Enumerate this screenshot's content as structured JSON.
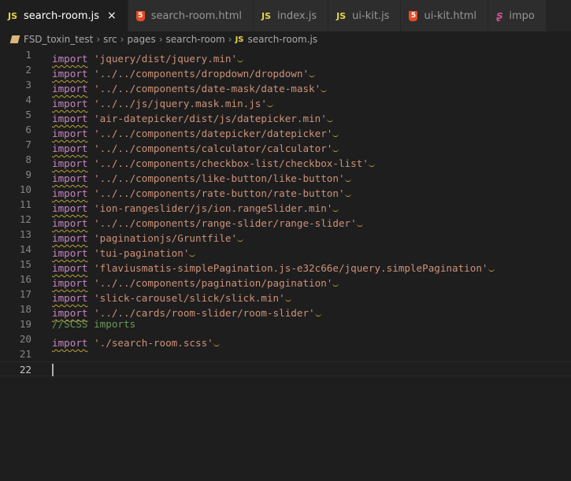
{
  "tabs": [
    {
      "icon": "js",
      "label": "search-room.js",
      "active": true
    },
    {
      "icon": "html",
      "label": "search-room.html",
      "active": false
    },
    {
      "icon": "js",
      "label": "index.js",
      "active": false
    },
    {
      "icon": "js",
      "label": "ui-kit.js",
      "active": false
    },
    {
      "icon": "html",
      "label": "ui-kit.html",
      "active": false
    },
    {
      "icon": "scss",
      "label": "impo",
      "active": false
    }
  ],
  "close_glyph": "×",
  "breadcrumb": {
    "segments": [
      "FSD_toxin_test",
      "src",
      "pages",
      "search-room"
    ],
    "file": "search-room.js"
  },
  "code": [
    {
      "n": "1",
      "kw": "import",
      "str": "'jquery/dist/jquery.min'"
    },
    {
      "n": "2",
      "kw": "import",
      "str": "'../../components/dropdown/dropdown'"
    },
    {
      "n": "3",
      "kw": "import",
      "str": "'../../components/date-mask/date-mask'"
    },
    {
      "n": "4",
      "kw": "import",
      "str": "'../../js/jquery.mask.min.js'"
    },
    {
      "n": "5",
      "kw": "import",
      "str": "'air-datepicker/dist/js/datepicker.min'"
    },
    {
      "n": "6",
      "kw": "import",
      "str": "'../../components/datepicker/datepicker'"
    },
    {
      "n": "7",
      "kw": "import",
      "str": "'../../components/calculator/calculator'"
    },
    {
      "n": "8",
      "kw": "import",
      "str": "'../../components/checkbox-list/checkbox-list'"
    },
    {
      "n": "9",
      "kw": "import",
      "str": "'../../components/like-button/like-button'"
    },
    {
      "n": "10",
      "kw": "import",
      "str": "'../../components/rate-button/rate-button'"
    },
    {
      "n": "11",
      "kw": "import",
      "str": "'ion-rangeslider/js/ion.rangeSlider.min'"
    },
    {
      "n": "12",
      "kw": "import",
      "str": "'../../components/range-slider/range-slider'"
    },
    {
      "n": "13",
      "kw": "import",
      "str": "'paginationjs/Gruntfile'"
    },
    {
      "n": "14",
      "kw": "import",
      "str": "'tui-pagination'"
    },
    {
      "n": "15",
      "kw": "import",
      "str": "'flaviusmatis-simplePagination.js-e32c66e/jquery.simplePagination'"
    },
    {
      "n": "16",
      "kw": "import",
      "str": "'../../components/pagination/pagination'"
    },
    {
      "n": "17",
      "kw": "import",
      "str": "'slick-carousel/slick/slick.min'"
    },
    {
      "n": "18",
      "kw": "import",
      "str": "'../../cards/room-slider/room-slider'"
    },
    {
      "n": "19",
      "comment": "//SCSS imports"
    },
    {
      "n": "20",
      "kw": "import",
      "str": "'./search-room.scss'"
    },
    {
      "n": "21"
    },
    {
      "n": "22",
      "current": true
    }
  ],
  "colors": {
    "background": "#1e1e1e",
    "keyword": "#c586c0",
    "string": "#ce9178",
    "comment": "#6a9955",
    "line_number": "#858585",
    "js_icon": "#e8d44d",
    "html_icon": "#e44d26",
    "warning_squiggle": "#b8a137"
  }
}
